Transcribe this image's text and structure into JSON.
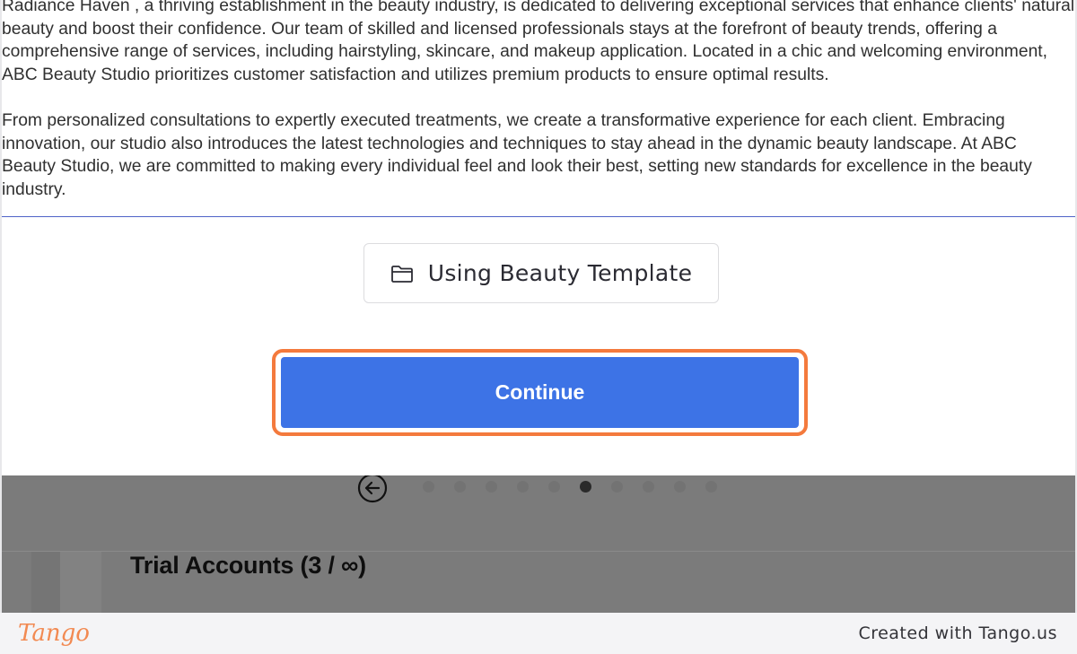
{
  "description": {
    "paragraphs": [
      "Radiance Haven , a thriving establishment in the beauty industry, is dedicated to delivering exceptional services that enhance clients' natural beauty and boost their confidence. Our team of skilled and licensed professionals stays at the forefront of beauty trends, offering a comprehensive range of services, including hairstyling, skincare, and makeup application. Located in a chic and welcoming environment, ABC Beauty Studio prioritizes customer satisfaction and utilizes premium products to ensure optimal results.",
      "From personalized consultations to expertly executed treatments, we create a transformative experience for each client. Embracing innovation, our studio also introduces the latest technologies and techniques to stay ahead in the dynamic beauty landscape. At ABC Beauty Studio, we are committed to making every individual feel and look their best, setting new standards for excellence in the beauty industry."
    ]
  },
  "template_button": {
    "label": "Using Beauty Template",
    "icon": "folder-icon"
  },
  "continue_button": {
    "label": "Continue",
    "color": "#3d73e6",
    "highlight": "#f47a3d"
  },
  "pagination": {
    "total": 10,
    "active_index": 5
  },
  "trial_accounts": {
    "title": "Trial Accounts (3 / ∞)"
  },
  "footer": {
    "logo": "Tango",
    "credit": "Created with Tango.us"
  }
}
